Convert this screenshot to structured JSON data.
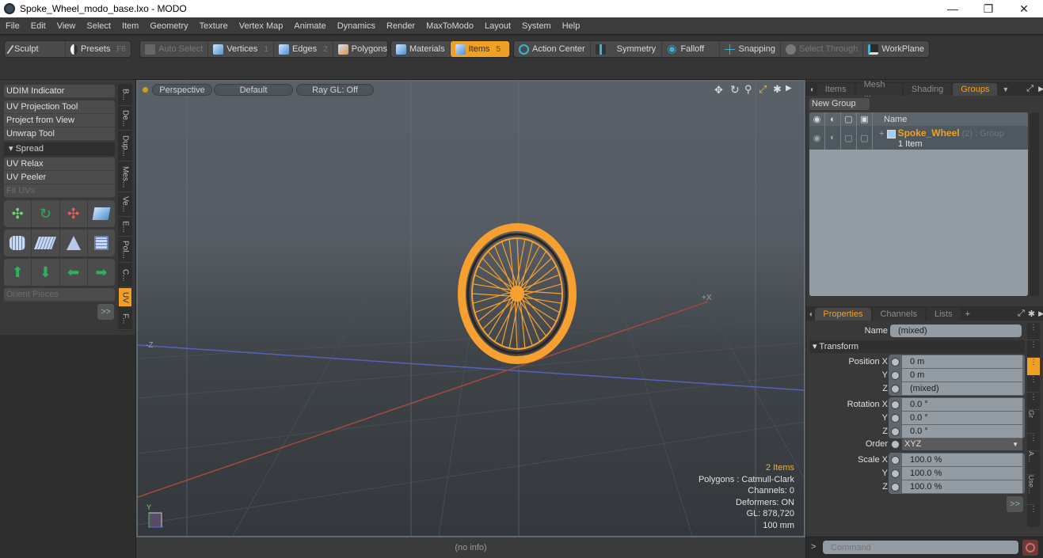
{
  "window": {
    "title": "Spoke_Wheel_modo_base.lxo - MODO",
    "controls": {
      "minimize": "—",
      "maximize": "❐",
      "close": "✕"
    }
  },
  "menu": [
    "File",
    "Edit",
    "View",
    "Select",
    "Item",
    "Geometry",
    "Texture",
    "Vertex Map",
    "Animate",
    "Dynamics",
    "Render",
    "MaxToModo",
    "Layout",
    "System",
    "Help"
  ],
  "toolbar": {
    "sculpt": "Sculpt",
    "presets": "Presets",
    "presets_key": "F6",
    "auto_select": "Auto Select",
    "vertices": "Vertices",
    "vertices_key": "1",
    "edges": "Edges",
    "edges_key": "2",
    "polygons": "Polygons",
    "materials": "Materials",
    "items": "Items",
    "items_key": "5",
    "action_center": "Action Center",
    "symmetry": "Symmetry",
    "falloff": "Falloff",
    "snapping": "Snapping",
    "select_through": "Select Through",
    "workplane": "WorkPlane"
  },
  "left_panel": {
    "udim": "UDIM Indicator",
    "uv_projection": "UV Projection Tool",
    "project_from_view": "Project from View",
    "unwrap": "Unwrap Tool",
    "spread": "Spread",
    "uv_relax": "UV Relax",
    "uv_peeler": "UV Peeler",
    "fit_uvs": "Fit UVs",
    "orient_pieces": "Orient Pieces",
    "more": ">>",
    "vtabs": [
      "B...",
      "De...",
      "Dup...",
      "Mes...",
      "Ve...",
      "E...",
      "Pol...",
      "C...",
      "UV",
      "F..."
    ]
  },
  "viewport": {
    "view": "Perspective",
    "shading": "Default",
    "raygl": "Ray GL: Off",
    "axis_neg_z": "-Z",
    "axis_pos_x": "+X",
    "axis_y": "Y",
    "info": {
      "items": "2 Items",
      "polygons": "Polygons : Catmull-Clark",
      "channels": "Channels: 0",
      "deformers": "Deformers: ON",
      "gl": "GL: 878,720",
      "scale": "100 mm"
    }
  },
  "status": "(no info)",
  "groups_panel": {
    "tabs": [
      "Items",
      "Mesh ...",
      "Shading",
      "Groups"
    ],
    "active_tab": "Groups",
    "new_group": "New Group",
    "name_col": "Name",
    "group_name": "Spoke_Wheel",
    "group_meta": "(2) : Group",
    "group_sub": "1 Item"
  },
  "properties_panel": {
    "tabs": [
      "Properties",
      "Channels",
      "Lists"
    ],
    "add_tab": "+",
    "name_label": "Name",
    "name_value": "(mixed)",
    "transform": "Transform",
    "position": {
      "label_x": "Position X",
      "label_y": "Y",
      "label_z": "Z",
      "x": "0 m",
      "y": "0 m",
      "z": "(mixed)"
    },
    "rotation": {
      "label_x": "Rotation X",
      "label_y": "Y",
      "label_z": "Z",
      "x": "0.0 °",
      "y": "0.0 °",
      "z": "0.0 °"
    },
    "order": {
      "label": "Order",
      "value": "XYZ"
    },
    "scale": {
      "label_x": "Scale X",
      "label_y": "Y",
      "label_z": "Z",
      "x": "100.0 %",
      "y": "100.0 %",
      "z": "100.0 %"
    },
    "more": ">>",
    "side_tabs": [
      "...",
      "...",
      "...",
      "...",
      "...",
      "Gr",
      "...",
      "...",
      "A...",
      "Use...",
      "..."
    ]
  },
  "command": {
    "prompt": ">",
    "placeholder": "Command"
  },
  "colors": {
    "accent": "#f0a024",
    "wheel": "#f5a030"
  }
}
